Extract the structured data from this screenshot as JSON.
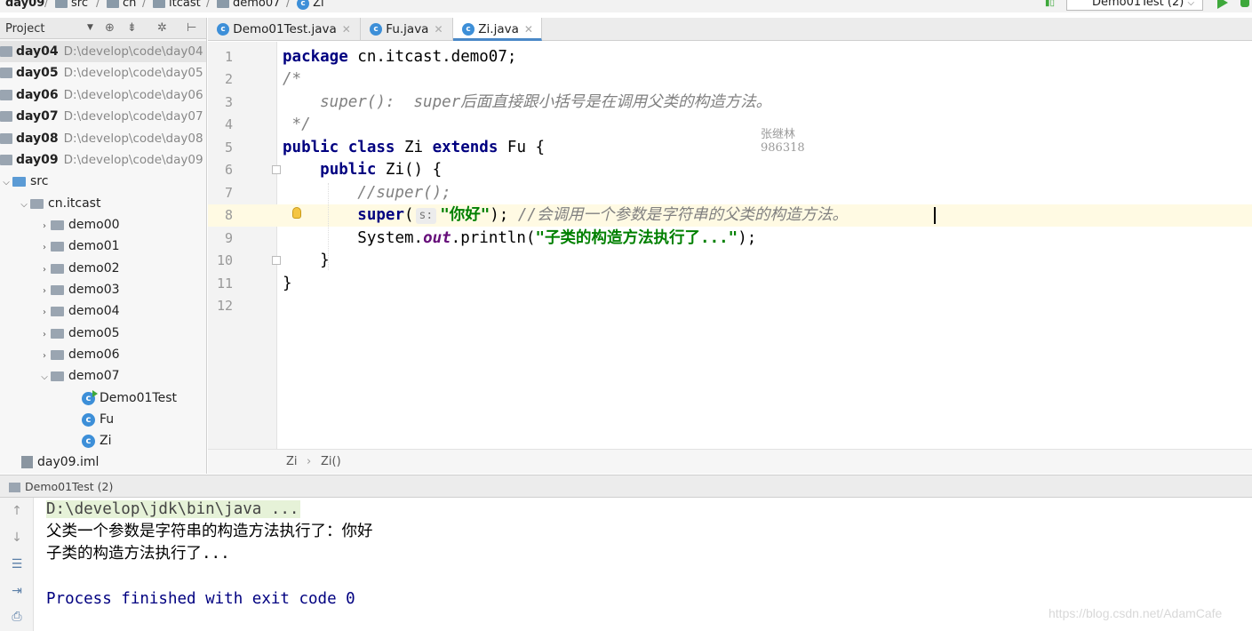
{
  "breadcrumb": {
    "items": [
      "day09",
      "src",
      "cn",
      "itcast",
      "demo07",
      "Zi"
    ]
  },
  "toolbar": {
    "run_config": "Demo01Test (2)"
  },
  "project_panel": {
    "title": "Project",
    "modules": [
      {
        "name": "day04",
        "path": "D:\\develop\\code\\day04"
      },
      {
        "name": "day05",
        "path": "D:\\develop\\code\\day05"
      },
      {
        "name": "day06",
        "path": "D:\\develop\\code\\day06"
      },
      {
        "name": "day07",
        "path": "D:\\develop\\code\\day07"
      },
      {
        "name": "day08",
        "path": "D:\\develop\\code\\day08"
      },
      {
        "name": "day09",
        "path": "D:\\develop\\code\\day09"
      }
    ],
    "src_label": "src",
    "package_label": "cn.itcast",
    "packages": [
      "demo00",
      "demo01",
      "demo02",
      "demo03",
      "demo04",
      "demo05",
      "demo06",
      "demo07"
    ],
    "classes": [
      "Demo01Test",
      "Fu",
      "Zi"
    ],
    "iml_file": "day09.iml"
  },
  "tabs": [
    {
      "label": "Demo01Test.java",
      "active": false
    },
    {
      "label": "Fu.java",
      "active": false
    },
    {
      "label": "Zi.java",
      "active": true
    }
  ],
  "editor": {
    "line_numbers": [
      "1",
      "2",
      "3",
      "4",
      "5",
      "6",
      "7",
      "8",
      "9",
      "10",
      "11",
      "12"
    ],
    "line1": {
      "kw": "package",
      "rest": " cn.itcast.demo07;"
    },
    "line2": "/*",
    "line3": "    super():  super后面直接跟小括号是在调用父类的构造方法。",
    "line4": " */",
    "line5": {
      "kw1": "public",
      "kw2": "class",
      "name": " Zi ",
      "kw3": "extends",
      "rest": " Fu {"
    },
    "line6": {
      "indent": "    ",
      "kw": "public",
      "rest": " Zi() {"
    },
    "line7": "        //super();",
    "line8": {
      "indent": "        ",
      "kw": "super",
      "paren": "(",
      "hint": "s:",
      "str": "\"你好\"",
      "end": ");",
      "comment": " //会调用一个参数是字符串的父类的构造方法。"
    },
    "line9": {
      "indent": "        ",
      "pre": "System.",
      "field": "out",
      "mid": ".println(",
      "str": "\"子类的构造方法执行了...\"",
      "end": ");"
    },
    "line10": "    }",
    "line11": "}",
    "watermark_name": "张继林",
    "watermark_num": "986318"
  },
  "editor_breadcrumb": {
    "class": "Zi",
    "method": "Zi()"
  },
  "run_panel": {
    "title": "Demo01Test (2)",
    "console": {
      "cmd": "D:\\develop\\jdk\\bin\\java ...",
      "out1": "父类一个参数是字符串的构造方法执行了：你好",
      "out2": "子类的构造方法执行了...",
      "exit": "Process finished with exit code 0"
    }
  },
  "watermark": "https://blog.csdn.net/AdamCafe"
}
